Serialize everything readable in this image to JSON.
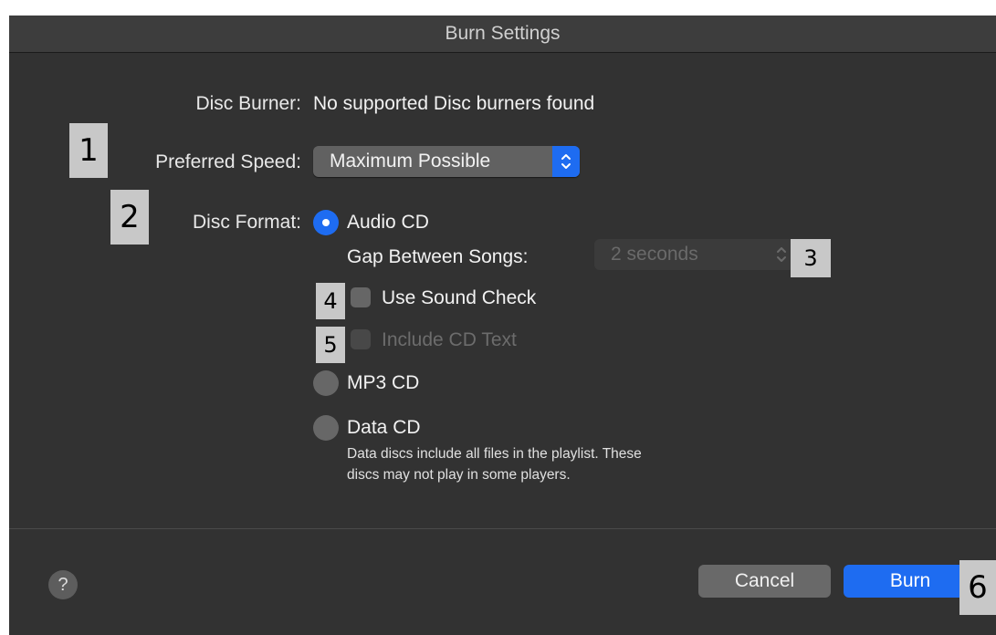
{
  "dialog": {
    "title": "Burn Settings"
  },
  "disc_burner": {
    "label": "Disc Burner:",
    "value": "No supported Disc burners found"
  },
  "preferred_speed": {
    "label": "Preferred Speed:",
    "selected": "Maximum Possible"
  },
  "disc_format": {
    "label": "Disc Format:",
    "options": [
      {
        "label": "Audio CD",
        "selected": true
      },
      {
        "label": "MP3 CD",
        "selected": false
      },
      {
        "label": "Data CD",
        "selected": false
      }
    ],
    "gap_label": "Gap Between Songs:",
    "gap_value": "2 seconds",
    "use_sound_check": {
      "label": "Use Sound Check",
      "checked": false
    },
    "include_cd_text": {
      "label": "Include CD Text",
      "checked": false,
      "enabled": false
    },
    "data_cd_note_line1": "Data discs include all files in the playlist. These",
    "data_cd_note_line2": "discs may not play in some players."
  },
  "footer": {
    "help": "?",
    "cancel": "Cancel",
    "burn": "Burn"
  },
  "annotations": [
    "1",
    "2",
    "3",
    "4",
    "5",
    "6"
  ],
  "colors": {
    "background": "#323232",
    "accent": "#1e6cf1",
    "control": "#616161",
    "tag": "#c8c8c8"
  }
}
